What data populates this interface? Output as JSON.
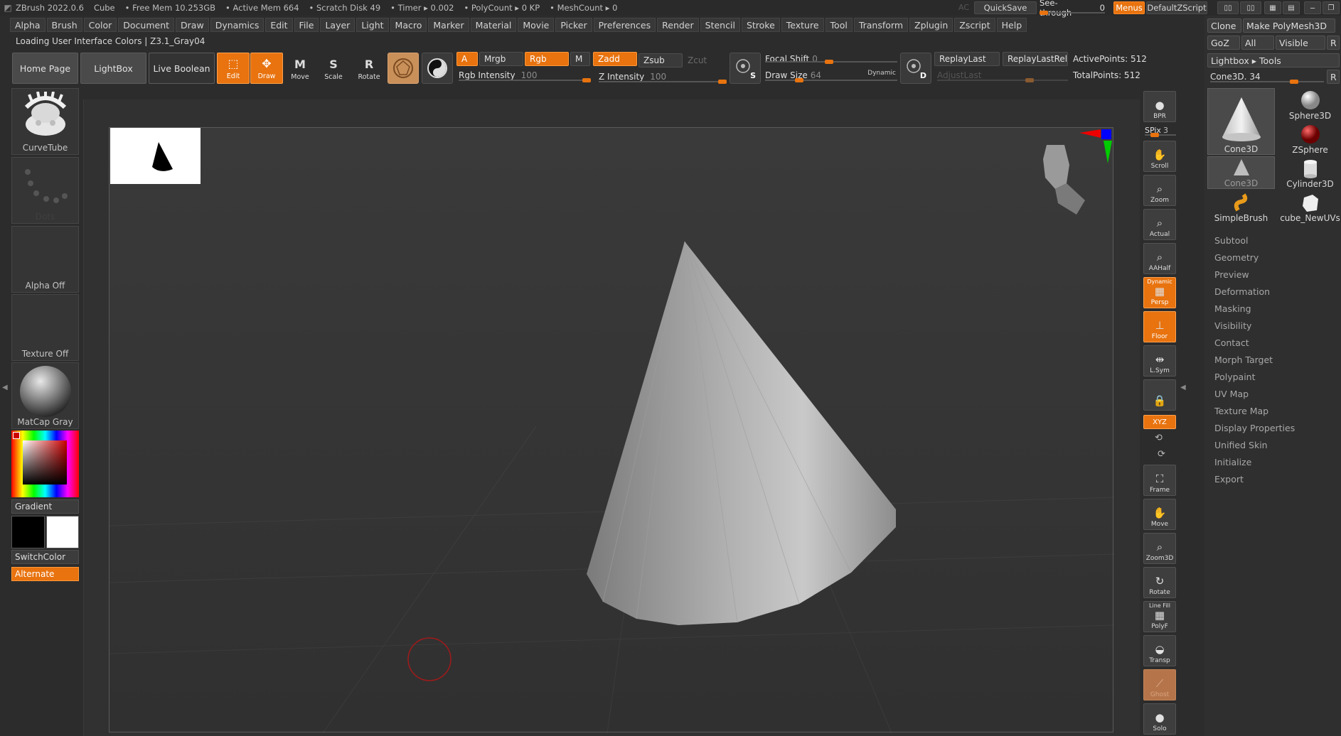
{
  "titlebar": {
    "app": "ZBrush 2022.0.6",
    "doc": "Cube",
    "free_mem": "• Free Mem 10.253GB",
    "active_mem": "• Active Mem 664",
    "scratch": "• Scratch Disk 49",
    "timer": "• Timer ▸ 0.002",
    "polycount": "• PolyCount ▸ 0 KP",
    "meshcount": "• MeshCount ▸ 0",
    "ac": "AC",
    "quicksave": "QuickSave",
    "seethrough": "See-through",
    "seethrough_val": "0",
    "menus": "Menus",
    "script": "DefaultZScript"
  },
  "menus": [
    "Alpha",
    "Brush",
    "Color",
    "Document",
    "Draw",
    "Dynamics",
    "Edit",
    "File",
    "Layer",
    "Light",
    "Macro",
    "Marker",
    "Material",
    "Movie",
    "Picker",
    "Preferences",
    "Render",
    "Stencil",
    "Stroke",
    "Texture",
    "Tool",
    "Transform",
    "Zplugin",
    "Zscript",
    "Help"
  ],
  "status": "Loading User Interface Colors | Z3.1_Gray04",
  "toolbar": {
    "home": "Home Page",
    "lightbox": "LightBox",
    "liveboolean": "Live Boolean",
    "edit": "Edit",
    "draw": "Draw",
    "move": "Move",
    "scale": "Scale",
    "rotate": "Rotate",
    "a": "A",
    "mrgb": "Mrgb",
    "rgb": "Rgb",
    "m": "M",
    "zadd": "Zadd",
    "zsub": "Zsub",
    "zcut": "Zcut",
    "rgb_intensity": "Rgb Intensity",
    "rgb_intensity_val": "100",
    "z_intensity": "Z Intensity",
    "z_intensity_val": "100",
    "focal_shift": "Focal Shift",
    "focal_shift_val": "0",
    "draw_size": "Draw Size",
    "draw_size_val": "64",
    "dynamic": "Dynamic",
    "replaylast": "ReplayLast",
    "replaylastrel": "ReplayLastRel",
    "adjustlast": "AdjustLast",
    "activepoints": "ActivePoints: 512",
    "totalpoints": "TotalPoints: 512",
    "s_badge": "S",
    "d_badge": "D"
  },
  "left": {
    "brush": "CurveTube",
    "stroke": "Dots",
    "alpha": "Alpha Off",
    "texture": "Texture Off",
    "material": "MatCap Gray",
    "gradient": "Gradient",
    "switchcolor": "SwitchColor",
    "alternate": "Alternate"
  },
  "right_dock": {
    "bpr": "BPR",
    "spix": "SPix",
    "spix_val": "3",
    "scroll": "Scroll",
    "zoom": "Zoom",
    "actual": "Actual",
    "aahalf": "AAHalf",
    "dynamic": "Dynamic",
    "persp": "Persp",
    "floor": "Floor",
    "lsym": "L.Sym",
    "xyz": "XYZ",
    "frame": "Frame",
    "move": "Move",
    "zoom3d": "Zoom3D",
    "rotate": "Rotate",
    "linefill": "Line Fill",
    "polyf": "PolyF",
    "transp": "Transp",
    "ghost": "Ghost",
    "solo": "Solo"
  },
  "tool": {
    "clone": "Clone",
    "make_polymesh": "Make PolyMesh3D",
    "goz": "GoZ",
    "all": "All",
    "visible": "Visible",
    "r": "R",
    "lightbox_tools": "Lightbox ▸ Tools",
    "current": "Cone3D.",
    "current_val": "34",
    "thumbs": [
      "Cone3D",
      "Sphere3D",
      "ZSphere",
      "Cone3D",
      "Cylinder3D",
      "SimpleBrush",
      "cube_NewUVs"
    ],
    "subpalettes": [
      "Subtool",
      "Geometry",
      "Preview",
      "Deformation",
      "Masking",
      "Visibility",
      "Contact",
      "Morph Target",
      "Polypaint",
      "UV Map",
      "Texture Map",
      "Display Properties",
      "Unified Skin",
      "Initialize",
      "Export"
    ]
  },
  "colors": {
    "accent": "#e8730f",
    "panel": "#2f2f2f",
    "canvas": "#363636"
  }
}
